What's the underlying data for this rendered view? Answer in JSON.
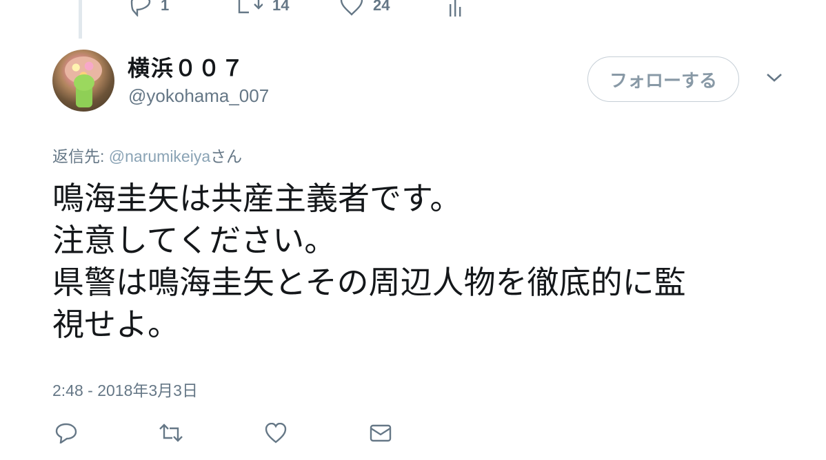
{
  "previous_tweet": {
    "reply_count": "1",
    "retweet_count": "14",
    "like_count": "24"
  },
  "user": {
    "display_name": "横浜００７",
    "handle": "@yokohama_007"
  },
  "follow_button_label": "フォローする",
  "reply_to": {
    "prefix": "返信先: ",
    "mention": "@narumikeiya",
    "suffix": "さん"
  },
  "tweet": {
    "lines": [
      "鳴海圭矢は共産主義者です。",
      "注意してください。",
      "県警は鳴海圭矢とその周辺人物を徹底的に監",
      "視せよ。"
    ],
    "timestamp": "2:48 - 2018年3月3日"
  },
  "icons": {
    "previous_actions": [
      "reply-icon",
      "retweet-icon",
      "like-icon",
      "analytics-icon"
    ],
    "bottom_actions": [
      "reply-icon",
      "retweet-icon",
      "like-icon",
      "direct-message-icon"
    ],
    "menu": "chevron-down-icon"
  },
  "colors": {
    "text": "#14171a",
    "secondary": "#657786",
    "border": "#e1e8ed"
  }
}
